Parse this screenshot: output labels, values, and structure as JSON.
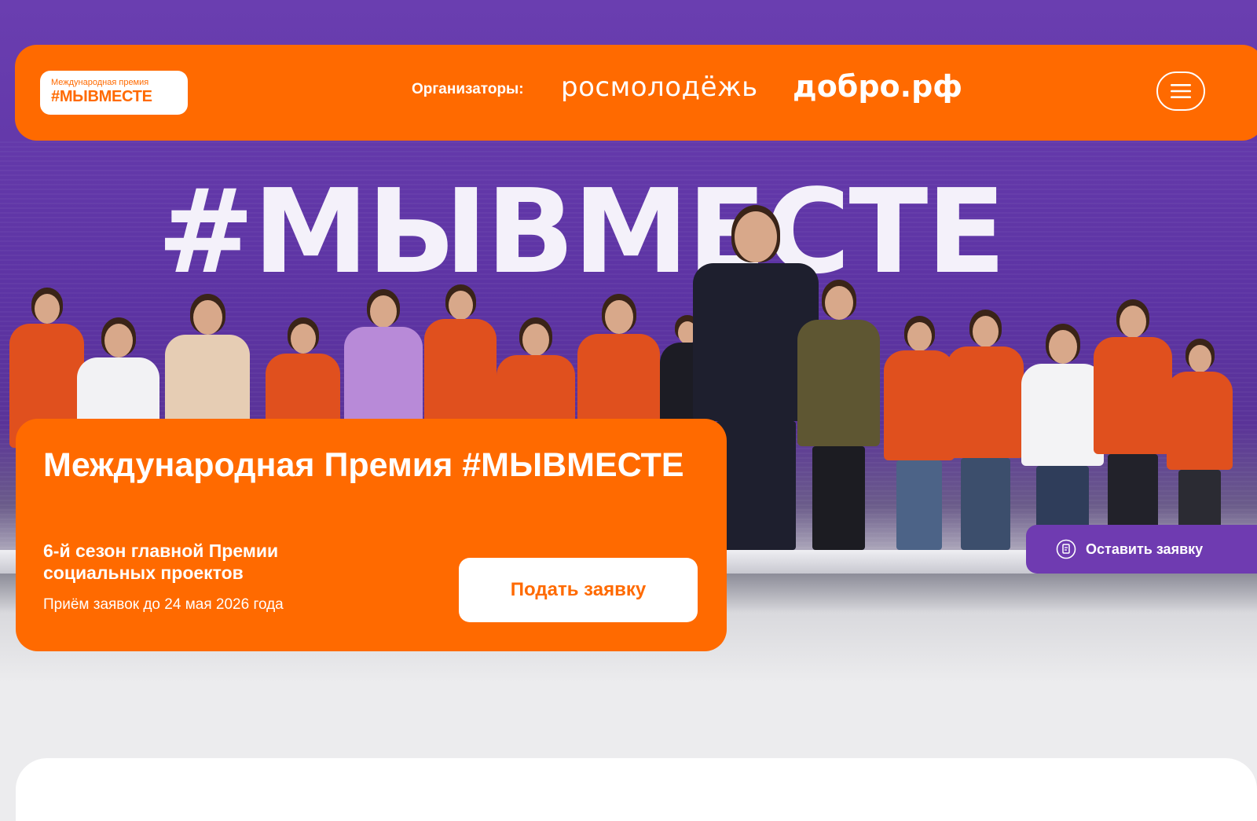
{
  "header": {
    "logo_line1": "Международная премия",
    "logo_line2": "#МЫВМЕСТЕ",
    "organizers_label": "Организаторы:",
    "organizer_1": "росмолодёжь",
    "organizer_2": "добро.рф",
    "menu_icon": "hamburger-menu-icon"
  },
  "hero": {
    "stage_text": "#МЫВМЕСТЕ"
  },
  "promo": {
    "title": "Международная Премия #МЫВМЕСТЕ",
    "subtitle": "6-й сезон главной Премии социальных проектов",
    "deadline": "Приём заявок до 24 мая 2026 года",
    "apply_label": "Подать заявку"
  },
  "floating": {
    "label": "Оставить заявку",
    "icon": "edit-document-icon"
  },
  "colors": {
    "brand_orange": "#ff6a00",
    "brand_purple": "#6f3bb1",
    "background": "#ececee"
  }
}
